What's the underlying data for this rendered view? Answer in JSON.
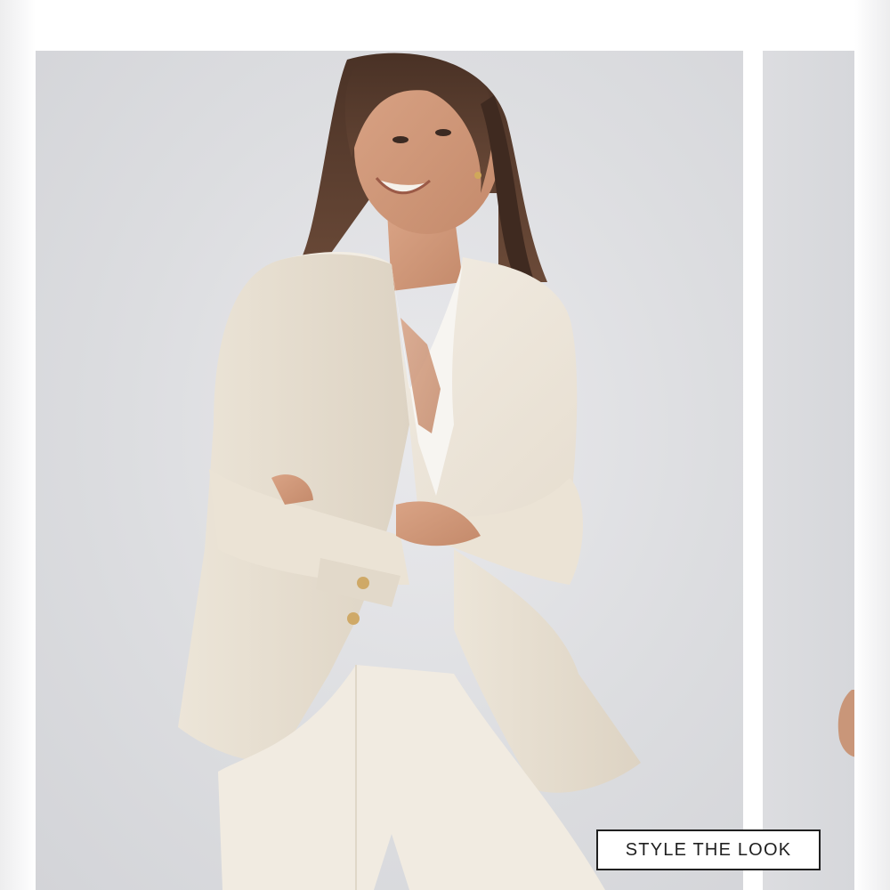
{
  "carousel": {
    "slides": [
      {
        "image": "woman-in-ivory-suit",
        "alt": ""
      },
      {
        "image": "next-look-partial",
        "alt": ""
      }
    ]
  },
  "cta": {
    "label": "STYLE THE LOOK"
  },
  "colors": {
    "background": "#ffffff",
    "photo_backdrop": "#dcdde0",
    "suit": "#efe9de",
    "cta_border": "#1f1f1f",
    "cta_text": "#1f1f1f"
  }
}
